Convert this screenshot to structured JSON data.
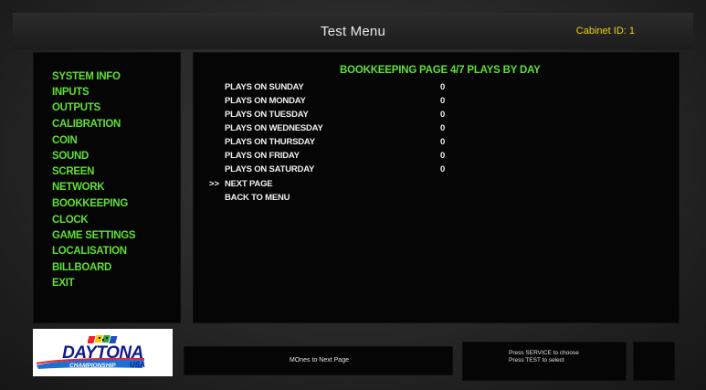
{
  "header": {
    "title": "Test Menu",
    "cabinet_id": "Cabinet ID: 1"
  },
  "menu": {
    "items": [
      {
        "label": "SYSTEM INFO"
      },
      {
        "label": "INPUTS"
      },
      {
        "label": "OUTPUTS"
      },
      {
        "label": "CALIBRATION"
      },
      {
        "label": "COIN"
      },
      {
        "label": "SOUND"
      },
      {
        "label": "SCREEN"
      },
      {
        "label": "NETWORK"
      },
      {
        "label": "BOOKKEEPING"
      },
      {
        "label": "CLOCK"
      },
      {
        "label": "GAME SETTINGS"
      },
      {
        "label": "LOCALISATION"
      },
      {
        "label": "BILLBOARD"
      },
      {
        "label": "EXIT"
      }
    ]
  },
  "page": {
    "heading": "BOOKKEEPING PAGE 4/7  PLAYS BY DAY",
    "rows": [
      {
        "label": "PLAYS ON SUNDAY",
        "value": "0"
      },
      {
        "label": "PLAYS ON MONDAY",
        "value": "0"
      },
      {
        "label": "PLAYS ON TUESDAY",
        "value": "0"
      },
      {
        "label": "PLAYS ON WEDNESDAY",
        "value": "0"
      },
      {
        "label": "PLAYS ON THURSDAY",
        "value": "0"
      },
      {
        "label": "PLAYS ON FRIDAY",
        "value": "0"
      },
      {
        "label": "PLAYS ON SATURDAY",
        "value": "0"
      }
    ],
    "cursor": ">>",
    "actions": [
      {
        "label": "NEXT PAGE"
      },
      {
        "label": "BACK TO MENU"
      }
    ]
  },
  "logo": {
    "name": "DAYTONA",
    "subtitle": "CHAMPIONSHIP",
    "suffix": "USA"
  },
  "footer": {
    "hint": "MOnes to Next Page",
    "help_line_1": "Press SERVICE to choose",
    "help_line_2": "Press TEST to select"
  },
  "colors": {
    "menu_text": "#5ee033",
    "cabinet_id": "#e8d21a",
    "row_text": "#f0f0f0",
    "logo_blue": "#0d1c8c"
  }
}
